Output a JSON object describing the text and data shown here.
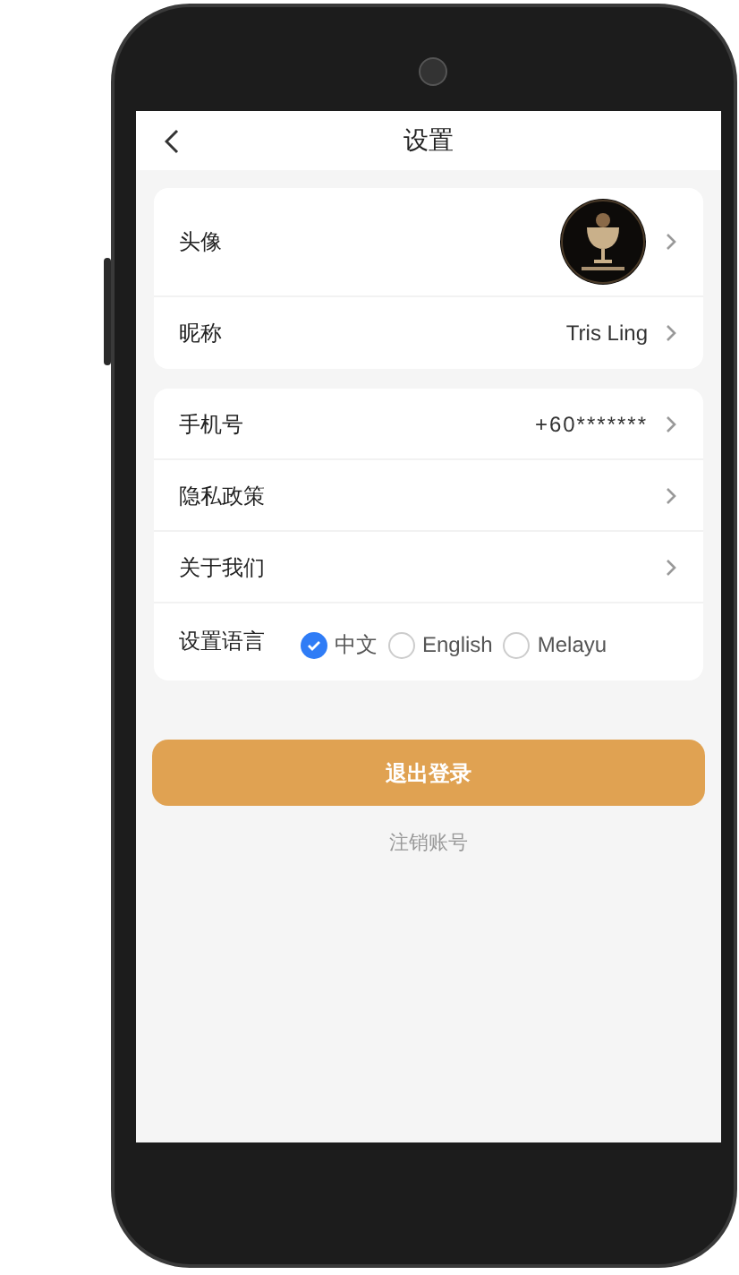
{
  "title": "设置",
  "groups": [
    {
      "rows": [
        {
          "kind": "avatar",
          "label": "头像"
        },
        {
          "kind": "value",
          "label": "昵称",
          "value": "Tris Ling"
        }
      ]
    },
    {
      "rows": [
        {
          "kind": "value",
          "label": "手机号",
          "value": "+60*******"
        },
        {
          "kind": "link",
          "label": "隐私政策"
        },
        {
          "kind": "link",
          "label": "关于我们"
        },
        {
          "kind": "language",
          "label": "设置语言",
          "options": [
            {
              "label": "中文",
              "selected": true
            },
            {
              "label": "English",
              "selected": false
            },
            {
              "label": "Melayu",
              "selected": false
            }
          ]
        }
      ]
    }
  ],
  "logout_button": "退出登录",
  "delete_account_link": "注销账号"
}
